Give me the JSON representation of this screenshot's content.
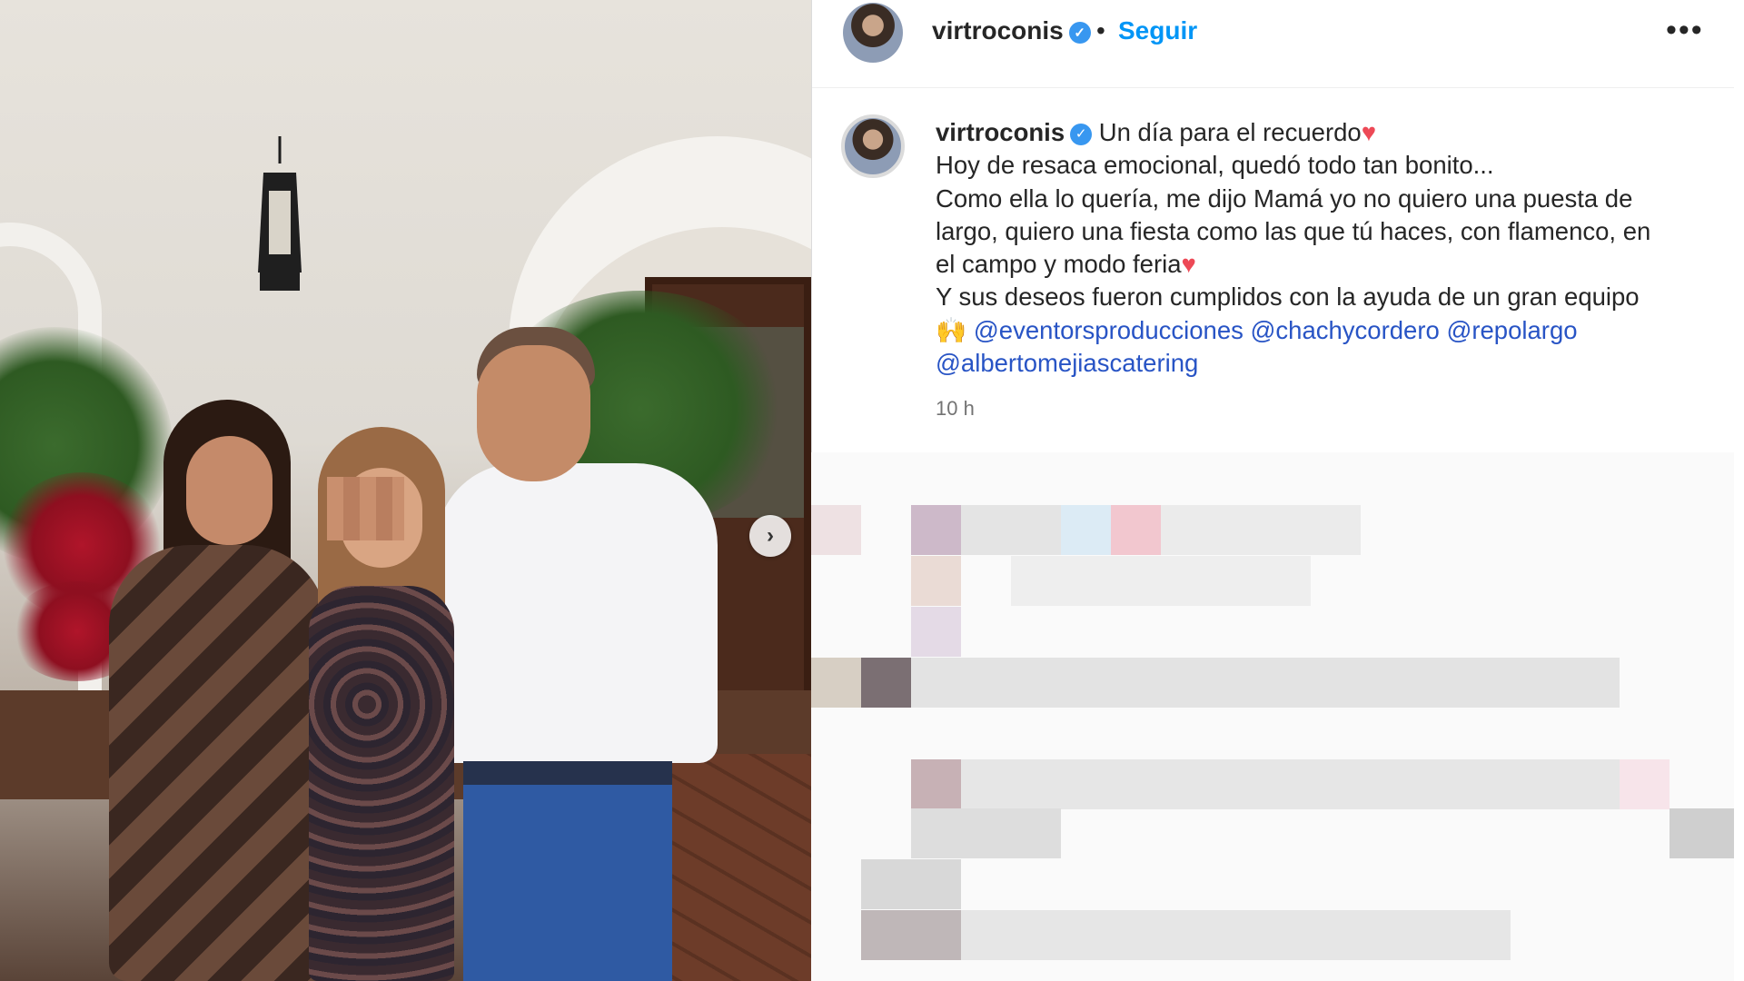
{
  "post": {
    "username": "virtroconis",
    "follow_label": "Seguir",
    "dot": "•",
    "more_label": "•••",
    "verified_mark": "✓",
    "carousel_next": "›",
    "caption": {
      "username": "virtroconis",
      "lines": [
        "Un día para el recuerdo",
        "Hoy de resaca emocional, quedó todo tan bonito...",
        "Como ella lo quería, me dijo Mamá yo no quiero una puesta de",
        "largo, quiero una fiesta como las que tú haces, con flamenco, en",
        "el campo y modo feria",
        "Y sus deseos fueron cumplidos con la ayuda de un gran equipo"
      ],
      "emoji_hands": "🙌",
      "heart": "♥",
      "mentions": [
        "@eventorsproducciones",
        "@chachycordero",
        "@repolargo",
        "@albertomejiascatering"
      ]
    },
    "time": "10 h"
  },
  "colors": {
    "link": "#0095f6",
    "mention": "#2854c5",
    "verified": "#3897f0",
    "heart": "#ed4956"
  }
}
